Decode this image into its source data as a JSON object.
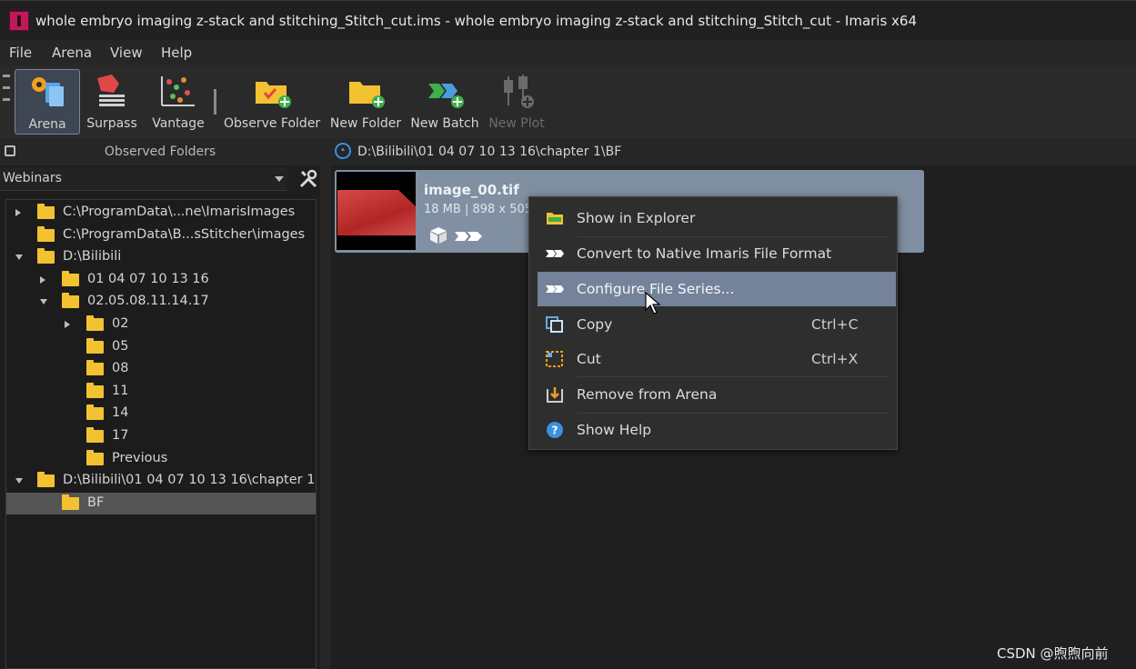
{
  "window": {
    "title": "whole embryo imaging z-stack and stitching_Stitch_cut.ims - whole embryo imaging z-stack and stitching_Stitch_cut - Imaris x64"
  },
  "menu": {
    "items": [
      "File",
      "Arena",
      "View",
      "Help"
    ]
  },
  "toolbar": {
    "buttons": [
      {
        "label": "Arena",
        "icon": "arena-icon",
        "active": true
      },
      {
        "label": "Surpass",
        "icon": "surpass-icon"
      },
      {
        "label": "Vantage",
        "icon": "vantage-icon"
      },
      {
        "label": "Observe Folder",
        "icon": "observe-folder-icon"
      },
      {
        "label": "New Folder",
        "icon": "new-folder-icon"
      },
      {
        "label": "New Batch",
        "icon": "new-batch-icon"
      },
      {
        "label": "New Plot",
        "icon": "new-plot-icon",
        "disabled": true
      }
    ]
  },
  "left_panel": {
    "title": "Observed Folders",
    "combo_value": "Webinars",
    "tree": [
      {
        "label": "C:\\ProgramData\\...ne\\ImarisImages",
        "twist": "closed"
      },
      {
        "label": "C:\\ProgramData\\B...sStitcher\\images",
        "twist": "none"
      },
      {
        "label": "D:\\Bilibili",
        "twist": "open"
      },
      {
        "label": "01 04 07 10 13 16",
        "twist": "closed"
      },
      {
        "label": "02.05.08.11.14.17",
        "twist": "open"
      },
      {
        "label": "02",
        "twist": "closed"
      },
      {
        "label": "05",
        "twist": "none"
      },
      {
        "label": "08",
        "twist": "none"
      },
      {
        "label": "11",
        "twist": "none"
      },
      {
        "label": "14",
        "twist": "none"
      },
      {
        "label": "17",
        "twist": "none"
      },
      {
        "label": "Previous",
        "twist": "none"
      },
      {
        "label": "D:\\Bilibili\\01 04 07 10 13 16\\chapter 1",
        "twist": "open"
      },
      {
        "label": "BF",
        "twist": "none",
        "selected": true
      }
    ]
  },
  "content": {
    "path": "D:\\Bilibili\\01 04 07 10 13 16\\chapter  1\\BF",
    "file": {
      "name": "image_00.tif",
      "info": "18 MB | 898 x 505"
    }
  },
  "context_menu": {
    "items": [
      {
        "label": "Show in Explorer",
        "icon": "folder-explorer-icon",
        "shortcut": ""
      },
      {
        "label": "Convert to Native Imaris File Format",
        "icon": "convert-icon",
        "shortcut": ""
      },
      {
        "label": "Configure File Series...",
        "icon": "file-series-icon",
        "shortcut": "",
        "highlighted": true
      },
      {
        "label": "Copy",
        "icon": "copy-icon",
        "shortcut": "Ctrl+C"
      },
      {
        "label": "Cut",
        "icon": "cut-icon",
        "shortcut": "Ctrl+X"
      },
      {
        "label": "Remove from Arena",
        "icon": "remove-icon",
        "shortcut": ""
      },
      {
        "label": "Show Help",
        "icon": "help-icon",
        "shortcut": ""
      }
    ]
  },
  "watermark": "CSDN @煦煦向前",
  "colors": {
    "accent_highlight": "#74829a",
    "file_card": "#8090a2",
    "folder": "#f2c230"
  }
}
